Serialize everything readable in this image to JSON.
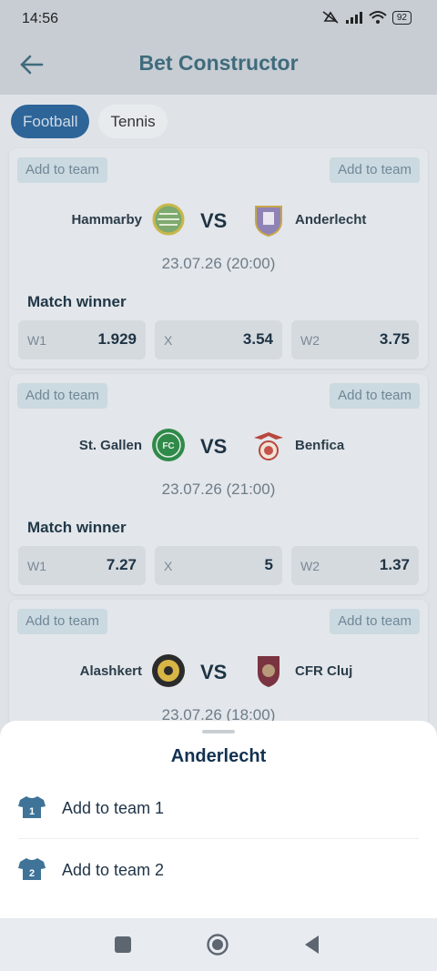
{
  "status": {
    "time": "14:56",
    "battery": "92"
  },
  "header": {
    "title": "Bet Constructor"
  },
  "tabs": [
    {
      "label": "Football",
      "active": true
    },
    {
      "label": "Tennis",
      "active": false
    }
  ],
  "matches": [
    {
      "team1": "Hammarby",
      "team2": "Anderlecht",
      "vs": "VS",
      "date": "23.07.26 (20:00)",
      "add_left": "Add to team",
      "add_right": "Add to team",
      "market": "Match winner",
      "odds": [
        {
          "label": "W1",
          "value": "1.929"
        },
        {
          "label": "X",
          "value": "3.54"
        },
        {
          "label": "W2",
          "value": "3.75"
        }
      ]
    },
    {
      "team1": "St. Gallen",
      "team2": "Benfica",
      "vs": "VS",
      "date": "23.07.26 (21:00)",
      "add_left": "Add to team",
      "add_right": "Add to team",
      "market": "Match winner",
      "odds": [
        {
          "label": "W1",
          "value": "7.27"
        },
        {
          "label": "X",
          "value": "5"
        },
        {
          "label": "W2",
          "value": "1.37"
        }
      ]
    },
    {
      "team1": "Alashkert",
      "team2": "CFR Cluj",
      "vs": "VS",
      "date": "23.07.26 (18:00)",
      "add_left": "Add to team",
      "add_right": "Add to team"
    }
  ],
  "sheet": {
    "title": "Anderlecht",
    "items": [
      {
        "label": "Add to team 1",
        "number": "1"
      },
      {
        "label": "Add to team 2",
        "number": "2"
      }
    ]
  },
  "colors": {
    "accent": "#2d6599",
    "sheet_title": "#123150",
    "shirt": "#3f7398"
  }
}
